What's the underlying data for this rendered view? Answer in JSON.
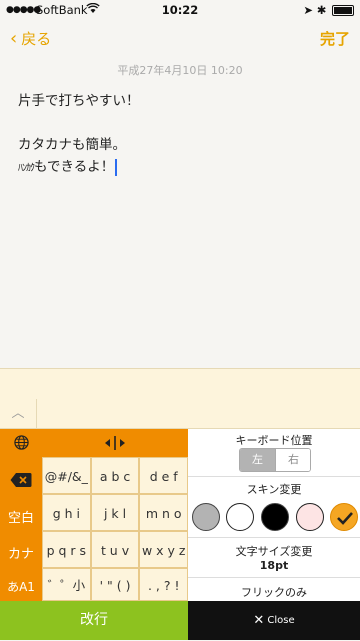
{
  "status": {
    "carrier": "SoftBank",
    "time": "10:22"
  },
  "nav": {
    "back": "戻る",
    "done": "完了"
  },
  "note": {
    "date": "平成27年4月10日 10:20",
    "line1": "片手で打ちやすい！",
    "line2": "カタカナも簡単。",
    "line3_half": "ﾊﾝｶｸ",
    "line3_rest": "もできるよ！"
  },
  "keyboard": {
    "side_keys": [
      "空白",
      "カナ",
      "あA1"
    ],
    "keys": [
      [
        "@#/&_",
        "a b c",
        "d e f"
      ],
      [
        "g h i",
        "j k l",
        "m n o"
      ],
      [
        "p q r s",
        "t u v",
        "w x y z"
      ],
      [
        "゛゜小",
        "' \" ( )",
        ". , ? !"
      ]
    ]
  },
  "settings": {
    "position_title": "キーボード位置",
    "left": "左",
    "right": "右",
    "skin_title": "スキン変更",
    "skins": [
      "#b3b3b3",
      "#ffffff",
      "#000000",
      "#fde4e4",
      "#f5a623"
    ],
    "size_title": "文字サイズ変更",
    "size_value": "18pt",
    "flick_label": "フリックのみ"
  },
  "bottom": {
    "enter": "改行",
    "close": "Close"
  }
}
